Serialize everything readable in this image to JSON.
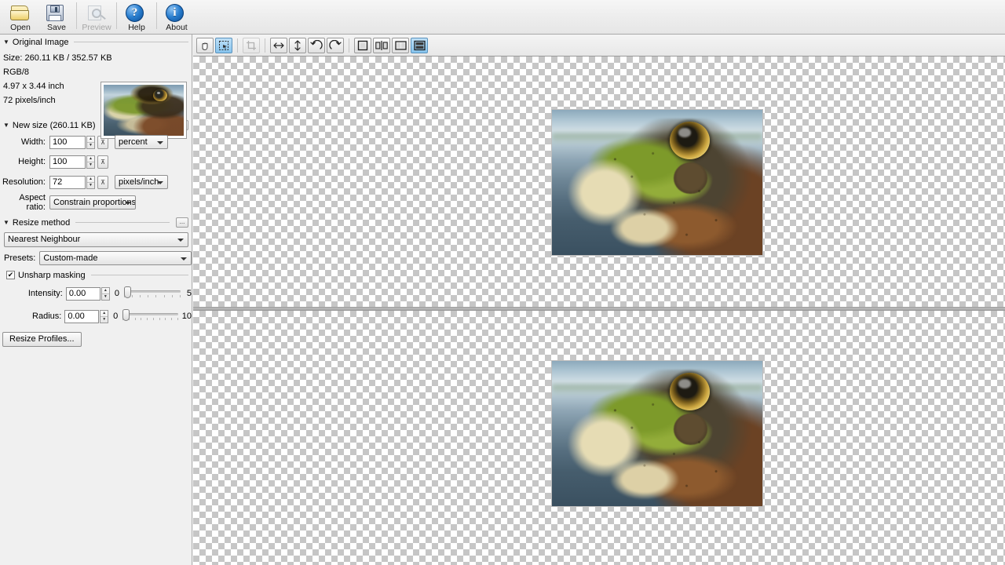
{
  "toolbar": {
    "buttons": [
      {
        "id": "open",
        "label": "Open",
        "icon": "folder-open-icon",
        "enabled": true
      },
      {
        "id": "save",
        "label": "Save",
        "icon": "floppy-disk-icon",
        "enabled": true
      },
      {
        "id": "preview",
        "label": "Preview",
        "icon": "magnifier-preview-icon",
        "enabled": false
      },
      {
        "id": "help",
        "label": "Help",
        "icon": "question-mark-icon",
        "enabled": true
      },
      {
        "id": "about",
        "label": "About",
        "icon": "info-icon",
        "enabled": true
      }
    ],
    "help_glyph": "?",
    "about_glyph": "i"
  },
  "sidebar": {
    "original": {
      "title": "Original Image",
      "triangle": "▼",
      "size": "Size: 260.11 KB / 352.57 KB",
      "color_mode": "RGB/8",
      "dimensions": "4.97 x 3.44 inch",
      "resolution": "72 pixels/inch"
    },
    "new_size": {
      "title": "New size (260.11 KB)",
      "triangle": "▼",
      "dots_label": "...",
      "width_label": "Width:",
      "width_value": "100",
      "width_unit": "percent",
      "height_label": "Height:",
      "height_value": "100",
      "resolution_label": "Resolution:",
      "resolution_value": "72",
      "resolution_unit": "pixels/inch",
      "aspect_label": "Aspect ratio:",
      "aspect_value": "Constrain proportions"
    },
    "resize_method": {
      "title": "Resize method",
      "triangle": "▼",
      "dots_label": "...",
      "method": "Nearest Neighbour",
      "presets_label": "Presets:",
      "presets_value": "Custom-made",
      "unsharp_label": "Unsharp masking",
      "unsharp_checked": true,
      "check_glyph": "✔",
      "intensity_label": "Intensity:",
      "intensity_value": "0.00",
      "intensity_min": "0",
      "intensity_max": "5",
      "radius_label": "Radius:",
      "radius_value": "0.00",
      "radius_min": "0",
      "radius_max": "10",
      "profiles_button": "Resize Profiles..."
    }
  },
  "canvas_toolbar": {
    "tools": [
      {
        "id": "pan",
        "name": "hand-pan-tool",
        "active": false,
        "enabled": true
      },
      {
        "id": "select",
        "name": "rectangle-select-tool",
        "active": true,
        "enabled": true
      },
      {
        "id": "crop",
        "name": "crop-tool",
        "active": false,
        "enabled": false
      },
      {
        "id": "flip-h",
        "name": "flip-horizontal",
        "active": false,
        "enabled": true
      },
      {
        "id": "flip-v",
        "name": "flip-vertical",
        "active": false,
        "enabled": true
      },
      {
        "id": "rotate-ccw",
        "name": "rotate-left",
        "active": false,
        "enabled": true
      },
      {
        "id": "rotate-cw",
        "name": "rotate-right",
        "active": false,
        "enabled": true
      },
      {
        "id": "view-single",
        "name": "view-single-pane",
        "active": false,
        "enabled": true
      },
      {
        "id": "view-split-h",
        "name": "view-split-compare",
        "active": false,
        "enabled": true
      },
      {
        "id": "view-split-v",
        "name": "view-two-columns",
        "active": false,
        "enabled": true
      },
      {
        "id": "view-stack",
        "name": "view-two-rows",
        "active": true,
        "enabled": true
      }
    ]
  },
  "canvas": {
    "top_pane_name": "original-image-pane",
    "bottom_pane_name": "resized-image-pane",
    "image_alt": "green frog head photograph",
    "background": "transparent-checkerboard"
  },
  "colors": {
    "accent": "#86c4ee",
    "toolbar_bg": "#ededed",
    "panel_bg": "#f0f0f0",
    "checker_light": "#ffffff",
    "checker_dark": "#c6c6c6",
    "divider": "#9c9c9c"
  }
}
